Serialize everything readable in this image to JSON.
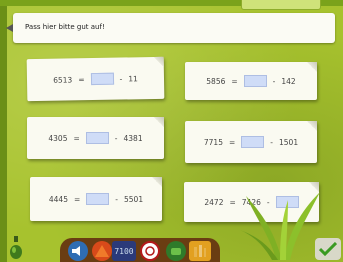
{
  "instruction": {
    "text": "Pass hier bitte gut auf!"
  },
  "exercises": [
    {
      "left": "6513",
      "op": "-",
      "right": "11",
      "layout": "lhs"
    },
    {
      "left": "5856",
      "op": "-",
      "right": "142",
      "layout": "lhs"
    },
    {
      "left": "4305",
      "op": "-",
      "right": "4381",
      "layout": "lhs"
    },
    {
      "left": "7715",
      "op": "-",
      "right": "1501",
      "layout": "lhs"
    },
    {
      "left": "4445",
      "op": "-",
      "right": "5501",
      "layout": "lhs"
    },
    {
      "left": "2472",
      "mid": "7426",
      "op": "-",
      "layout": "rhs"
    }
  ],
  "toolbar": {
    "clock_text": "7100"
  },
  "colors": {
    "background": "#a7c22e",
    "answer_box": "#cfdcf7",
    "card": "#fafaf1",
    "toolbar": "#6a3d12"
  },
  "icons": [
    "speaker-icon",
    "hat-icon",
    "clock-icon",
    "help-icon",
    "hint-icon",
    "fence-icon",
    "check-icon",
    "potion-icon",
    "plant-icon"
  ]
}
